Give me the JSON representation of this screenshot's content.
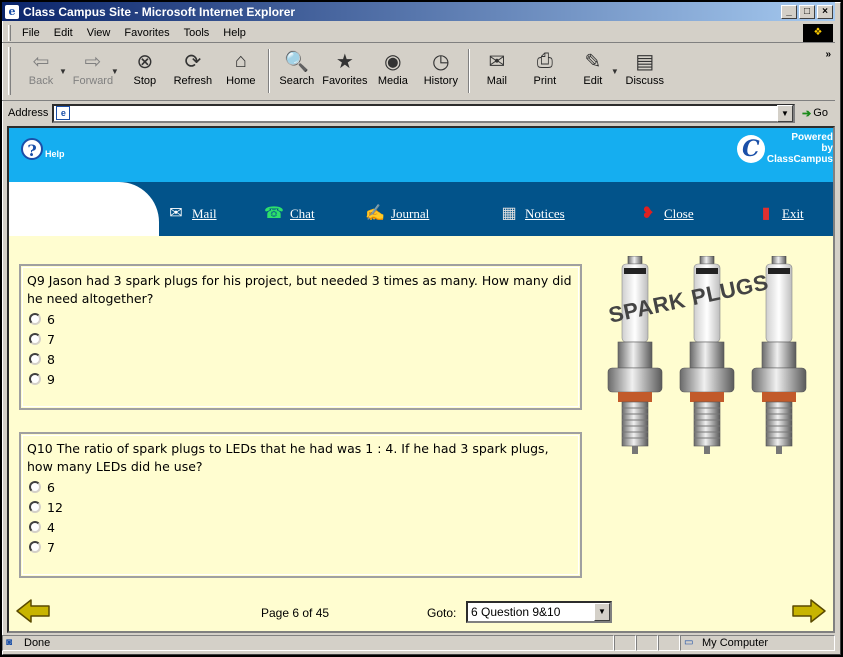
{
  "window": {
    "title": "Class Campus Site - Microsoft Internet Explorer",
    "controls": [
      "_",
      "□",
      "×"
    ]
  },
  "menu": [
    "File",
    "Edit",
    "View",
    "Favorites",
    "Tools",
    "Help"
  ],
  "toolbar": {
    "back": "Back",
    "forward": "Forward",
    "stop": "Stop",
    "refresh": "Refresh",
    "home": "Home",
    "search": "Search",
    "favorites": "Favorites",
    "media": "Media",
    "history": "History",
    "mail": "Mail",
    "print": "Print",
    "edit": "Edit",
    "discuss": "Discuss",
    "more": "»"
  },
  "address": {
    "label": "Address",
    "value": "",
    "go": "Go"
  },
  "site": {
    "help": "Help",
    "powered_line1": "Powered",
    "powered_line2": "by",
    "powered_line3": "ClassCampus",
    "nav": {
      "mail": "Mail",
      "chat": "Chat",
      "journal": "Journal",
      "notices": "Notices",
      "close": "Close",
      "exit": "Exit"
    }
  },
  "questions": [
    {
      "text": "Q9 Jason had 3 spark plugs for his project, but needed 3 times as many. How many did he need altogether?",
      "options": [
        "6",
        "7",
        "8",
        "9"
      ]
    },
    {
      "text": "Q10 The ratio of spark plugs to LEDs that he had was 1 : 4. If he had 3 spark plugs, how many LEDs did he use?",
      "options": [
        "6",
        "12",
        "4",
        "7"
      ]
    }
  ],
  "image": {
    "caption": "SPARK PLUGS"
  },
  "pager": {
    "page_info": "Page 6 of 45",
    "goto_label": "Goto:",
    "goto_value": "6 Question 9&10"
  },
  "status": {
    "left": "Done",
    "zone": "My Computer"
  }
}
